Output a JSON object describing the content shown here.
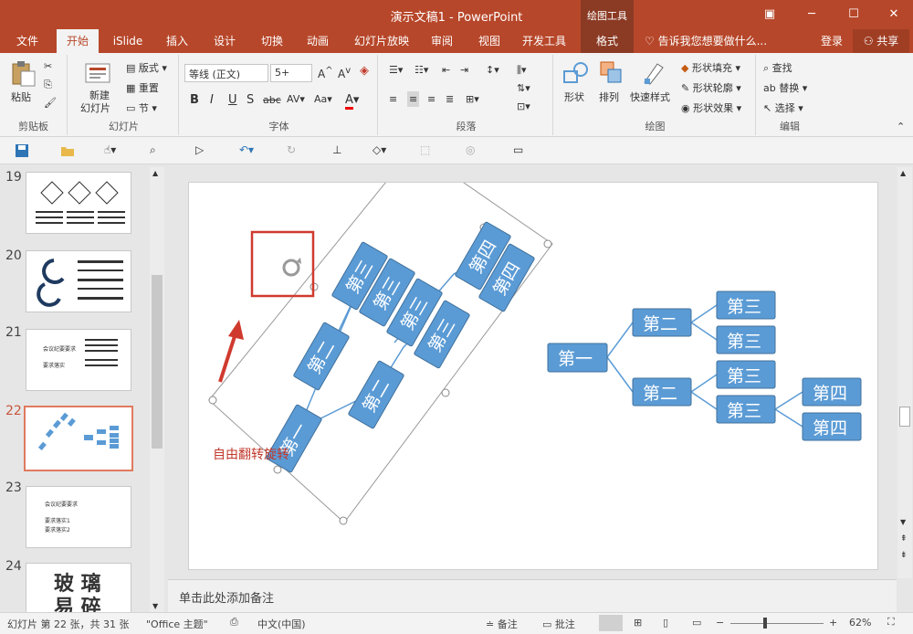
{
  "window": {
    "title": "演示文稿1 - PowerPoint",
    "context_header": "绘图工具"
  },
  "tabs": [
    "文件",
    "开始",
    "iSlide",
    "插入",
    "设计",
    "切换",
    "动画",
    "幻灯片放映",
    "审阅",
    "视图",
    "开发工具",
    "格式"
  ],
  "tell_me": "告诉我您想要做什么...",
  "login": "登录",
  "share": "共享",
  "ribbon": {
    "clipboard": {
      "paste": "粘贴",
      "label": "剪贴板"
    },
    "slides": {
      "new_slide_1": "新建",
      "new_slide_2": "幻灯片",
      "layout": "版式",
      "reset": "重置",
      "section": "节",
      "label": "幻灯片"
    },
    "font": {
      "name": "等线 (正文)",
      "size": "5+",
      "label": "字体"
    },
    "paragraph": {
      "label": "段落"
    },
    "drawing": {
      "shapes": "形状",
      "arrange": "排列",
      "quick_styles": "快速样式",
      "fill": "形状填充",
      "outline": "形状轮廓",
      "effects": "形状效果",
      "label": "绘图"
    },
    "editing": {
      "find": "查找",
      "replace": "替换",
      "select": "选择",
      "label": "编辑"
    }
  },
  "thumbnails": [
    {
      "num": "19"
    },
    {
      "num": "20"
    },
    {
      "num": "21",
      "lines": [
        "会议纪要要求",
        "要求落实"
      ]
    },
    {
      "num": "22"
    },
    {
      "num": "23",
      "lines": [
        "会议纪要要求",
        "要求落实1",
        "要求落实2"
      ]
    },
    {
      "num": "24",
      "lines": [
        "玻 璃",
        "易 碎"
      ]
    }
  ],
  "slide": {
    "annotation": "自由翻转旋转",
    "rotated_nodes": [
      "第一",
      "第二",
      "第二",
      "第三",
      "第三",
      "第三",
      "第三",
      "第四",
      "第四"
    ],
    "tree": {
      "root": "第一",
      "level2": [
        "第二",
        "第二"
      ],
      "level3": [
        "第三",
        "第三",
        "第三",
        "第三"
      ],
      "level4": [
        "第四",
        "第四"
      ]
    }
  },
  "notes": "单击此处添加备注",
  "status": {
    "slide_info": "幻灯片 第 22 张，共 31 张",
    "theme": "\"Office 主题\"",
    "language": "中文(中国)",
    "notes_btn": "备注",
    "comments_btn": "批注",
    "zoom": "62%"
  },
  "colors": {
    "accent": "#b7472a",
    "node": "#5b9bd5",
    "annotation": "#c0392b"
  }
}
